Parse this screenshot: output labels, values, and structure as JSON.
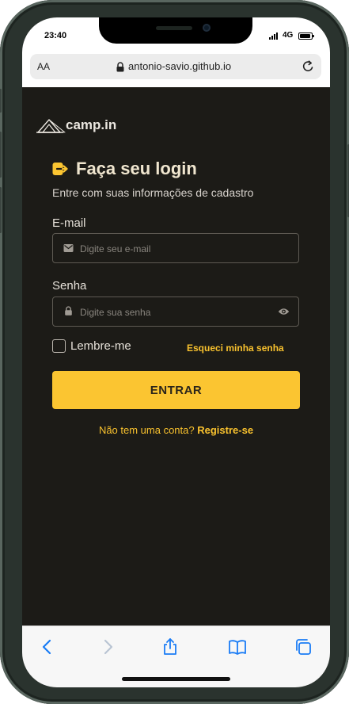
{
  "status_bar": {
    "time": "23:40",
    "network": "4G"
  },
  "browser": {
    "text_size_label": "AA",
    "url": "antonio-savio.github.io"
  },
  "app": {
    "logo_text": "camp.in",
    "title": "Faça seu login",
    "subtitle": "Entre com suas informações de cadastro",
    "email": {
      "label": "E-mail",
      "placeholder": "Digite seu e-mail",
      "value": ""
    },
    "password": {
      "label": "Senha",
      "placeholder": "Digite sua senha",
      "value": ""
    },
    "remember_label": "Lembre-me",
    "remember_checked": false,
    "forgot_link": "Esqueci minha senha",
    "submit_label": "ENTRAR",
    "signup_prompt": "Não tem uma conta?",
    "signup_link": "Registre-se",
    "colors": {
      "accent": "#fbc531",
      "background": "#1c1b17"
    }
  },
  "toolbar": {
    "icons": [
      "back-icon",
      "forward-icon",
      "share-icon",
      "bookmarks-icon",
      "tabs-icon"
    ]
  }
}
